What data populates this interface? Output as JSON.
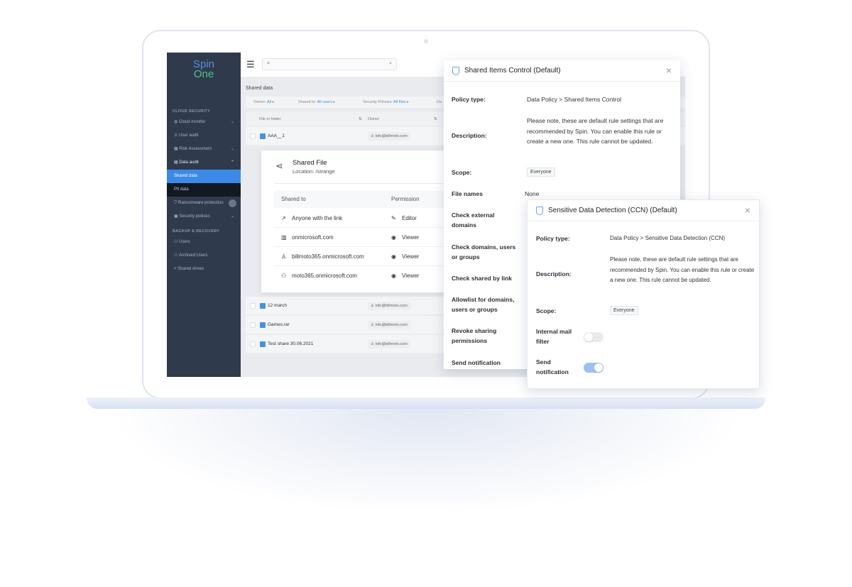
{
  "app": {
    "logo_line1": "Spin",
    "logo_line2": "One"
  },
  "sidebar": {
    "section1": "CLOUD SECURITY",
    "section2": "BACKUP & RECOVERY",
    "items": [
      {
        "label": "Cloud monitor",
        "icon": "globe-icon",
        "chevron": "⌄"
      },
      {
        "label": "User audit",
        "icon": "user-icon"
      },
      {
        "label": "Risk Assessment",
        "icon": "grid-icon",
        "chevron": "⌄"
      },
      {
        "label": "Data audit",
        "icon": "document-icon",
        "chevron": "⌃"
      },
      {
        "label": "Shared data"
      },
      {
        "label": "PII data"
      },
      {
        "label": "Ransomware protection",
        "icon": "shield-icon"
      },
      {
        "label": "Security policies",
        "icon": "policy-icon",
        "chevron": "⌄"
      },
      {
        "label": "Users",
        "icon": "users-icon"
      },
      {
        "label": "Archived Users",
        "icon": "users-icon"
      },
      {
        "label": "Shared drives",
        "icon": "share-icon"
      }
    ]
  },
  "topbar": {
    "menu_icon": "☰",
    "search_icon": "⌕",
    "share_icon": "<"
  },
  "content": {
    "title": "Shared data",
    "filters": [
      {
        "label": "Owner:",
        "value": "All"
      },
      {
        "label": "Shared to:",
        "value": "All users"
      },
      {
        "label": "Security Policies:",
        "value": "All files"
      },
      {
        "label": "Da",
        "value": ""
      }
    ],
    "columns": [
      "File or folder",
      "Owner"
    ],
    "rows": [
      {
        "name": "AAA__1",
        "owner": "info@billmoto.com"
      },
      {
        "name": "12 march",
        "owner": "info@billmoto.com"
      },
      {
        "name": "Games.rar",
        "owner": "info@billmoto.com"
      },
      {
        "name": "Test share 30.06.2021",
        "owner": "info@billmoto.com"
      }
    ]
  },
  "shared_file": {
    "title": "Shared File",
    "location": "Location: /strange",
    "col_shared_to": "Shared to",
    "col_permission": "Permission",
    "rows": [
      {
        "target": "Anyone with the link",
        "permission": "Editor",
        "icon": "link-icon"
      },
      {
        "target": "onmicrosoft.com",
        "permission": "Viewer",
        "icon": "building-icon"
      },
      {
        "target": "billmoto365.onmicrosoft.com",
        "permission": "Viewer",
        "icon": "user-icon"
      },
      {
        "target": "moto365.onmicrosoft.com",
        "permission": "Viewer",
        "icon": "group-icon"
      }
    ]
  },
  "modal1": {
    "title": "Shared Items Control (Default)",
    "policy_label": "Policy type:",
    "policy_value": "Data Policy  >  Shared Items Control",
    "desc_label": "Description:",
    "desc_value": "Please note, these are default rule settings that are recommended by Spin. You can enable this rule or create a new one. This rule cannot be updated.",
    "scope_label": "Scope:",
    "scope_value": "Everyone",
    "file_names_label": "File names",
    "file_names_value": "None",
    "fields": [
      "Check external domains",
      "Check domains, users or groups",
      "Check shared by link",
      "Allowlist for domains, users or groups",
      "Revoke sharing permissions",
      "Send notification"
    ]
  },
  "modal2": {
    "title": "Sensitive Data Detection (CCN) (Default)",
    "policy_label": "Policy type:",
    "policy_value": "Data Policy  >  Sensitive Data Detection (CCN)",
    "desc_label": "Description:",
    "desc_value": "Please note, these are default rule settings that are recommended by Spin. You can enable this rule or create a new one. This rule cannot be updated.",
    "scope_label": "Scope:",
    "scope_value": "Everyone",
    "internal_mail_label": "Internal mail filter",
    "internal_mail_on": false,
    "send_notification_label": "Send notification",
    "send_notification_on": true
  },
  "colors": {
    "accent": "#3d8ae6",
    "sidebar": "#2f3b4c",
    "logo_blue": "#5a8de0",
    "logo_green": "#4fc08d"
  }
}
